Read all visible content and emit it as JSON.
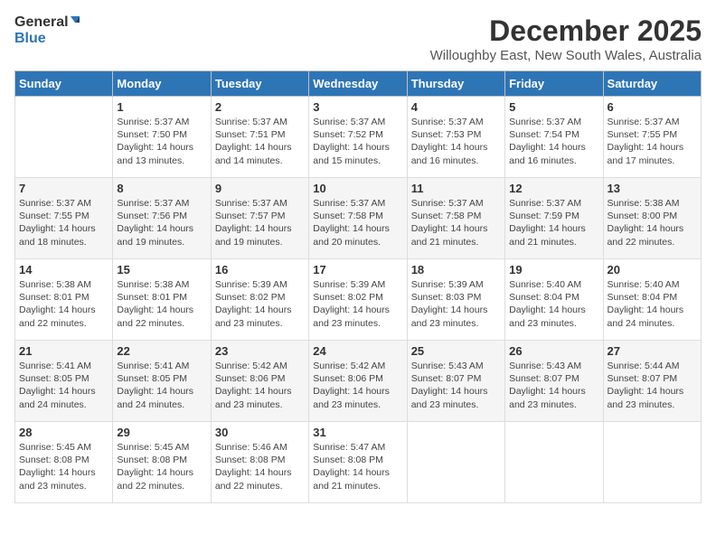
{
  "logo": {
    "general": "General",
    "blue": "Blue"
  },
  "title": "December 2025",
  "subtitle": "Willoughby East, New South Wales, Australia",
  "weekdays": [
    "Sunday",
    "Monday",
    "Tuesday",
    "Wednesday",
    "Thursday",
    "Friday",
    "Saturday"
  ],
  "weeks": [
    [
      {
        "day": "",
        "content": ""
      },
      {
        "day": "1",
        "content": "Sunrise: 5:37 AM\nSunset: 7:50 PM\nDaylight: 14 hours\nand 13 minutes."
      },
      {
        "day": "2",
        "content": "Sunrise: 5:37 AM\nSunset: 7:51 PM\nDaylight: 14 hours\nand 14 minutes."
      },
      {
        "day": "3",
        "content": "Sunrise: 5:37 AM\nSunset: 7:52 PM\nDaylight: 14 hours\nand 15 minutes."
      },
      {
        "day": "4",
        "content": "Sunrise: 5:37 AM\nSunset: 7:53 PM\nDaylight: 14 hours\nand 16 minutes."
      },
      {
        "day": "5",
        "content": "Sunrise: 5:37 AM\nSunset: 7:54 PM\nDaylight: 14 hours\nand 16 minutes."
      },
      {
        "day": "6",
        "content": "Sunrise: 5:37 AM\nSunset: 7:55 PM\nDaylight: 14 hours\nand 17 minutes."
      }
    ],
    [
      {
        "day": "7",
        "content": "Sunrise: 5:37 AM\nSunset: 7:55 PM\nDaylight: 14 hours\nand 18 minutes."
      },
      {
        "day": "8",
        "content": "Sunrise: 5:37 AM\nSunset: 7:56 PM\nDaylight: 14 hours\nand 19 minutes."
      },
      {
        "day": "9",
        "content": "Sunrise: 5:37 AM\nSunset: 7:57 PM\nDaylight: 14 hours\nand 19 minutes."
      },
      {
        "day": "10",
        "content": "Sunrise: 5:37 AM\nSunset: 7:58 PM\nDaylight: 14 hours\nand 20 minutes."
      },
      {
        "day": "11",
        "content": "Sunrise: 5:37 AM\nSunset: 7:58 PM\nDaylight: 14 hours\nand 21 minutes."
      },
      {
        "day": "12",
        "content": "Sunrise: 5:37 AM\nSunset: 7:59 PM\nDaylight: 14 hours\nand 21 minutes."
      },
      {
        "day": "13",
        "content": "Sunrise: 5:38 AM\nSunset: 8:00 PM\nDaylight: 14 hours\nand 22 minutes."
      }
    ],
    [
      {
        "day": "14",
        "content": "Sunrise: 5:38 AM\nSunset: 8:01 PM\nDaylight: 14 hours\nand 22 minutes."
      },
      {
        "day": "15",
        "content": "Sunrise: 5:38 AM\nSunset: 8:01 PM\nDaylight: 14 hours\nand 22 minutes."
      },
      {
        "day": "16",
        "content": "Sunrise: 5:39 AM\nSunset: 8:02 PM\nDaylight: 14 hours\nand 23 minutes."
      },
      {
        "day": "17",
        "content": "Sunrise: 5:39 AM\nSunset: 8:02 PM\nDaylight: 14 hours\nand 23 minutes."
      },
      {
        "day": "18",
        "content": "Sunrise: 5:39 AM\nSunset: 8:03 PM\nDaylight: 14 hours\nand 23 minutes."
      },
      {
        "day": "19",
        "content": "Sunrise: 5:40 AM\nSunset: 8:04 PM\nDaylight: 14 hours\nand 23 minutes."
      },
      {
        "day": "20",
        "content": "Sunrise: 5:40 AM\nSunset: 8:04 PM\nDaylight: 14 hours\nand 24 minutes."
      }
    ],
    [
      {
        "day": "21",
        "content": "Sunrise: 5:41 AM\nSunset: 8:05 PM\nDaylight: 14 hours\nand 24 minutes."
      },
      {
        "day": "22",
        "content": "Sunrise: 5:41 AM\nSunset: 8:05 PM\nDaylight: 14 hours\nand 24 minutes."
      },
      {
        "day": "23",
        "content": "Sunrise: 5:42 AM\nSunset: 8:06 PM\nDaylight: 14 hours\nand 23 minutes."
      },
      {
        "day": "24",
        "content": "Sunrise: 5:42 AM\nSunset: 8:06 PM\nDaylight: 14 hours\nand 23 minutes."
      },
      {
        "day": "25",
        "content": "Sunrise: 5:43 AM\nSunset: 8:07 PM\nDaylight: 14 hours\nand 23 minutes."
      },
      {
        "day": "26",
        "content": "Sunrise: 5:43 AM\nSunset: 8:07 PM\nDaylight: 14 hours\nand 23 minutes."
      },
      {
        "day": "27",
        "content": "Sunrise: 5:44 AM\nSunset: 8:07 PM\nDaylight: 14 hours\nand 23 minutes."
      }
    ],
    [
      {
        "day": "28",
        "content": "Sunrise: 5:45 AM\nSunset: 8:08 PM\nDaylight: 14 hours\nand 23 minutes."
      },
      {
        "day": "29",
        "content": "Sunrise: 5:45 AM\nSunset: 8:08 PM\nDaylight: 14 hours\nand 22 minutes."
      },
      {
        "day": "30",
        "content": "Sunrise: 5:46 AM\nSunset: 8:08 PM\nDaylight: 14 hours\nand 22 minutes."
      },
      {
        "day": "31",
        "content": "Sunrise: 5:47 AM\nSunset: 8:08 PM\nDaylight: 14 hours\nand 21 minutes."
      },
      {
        "day": "",
        "content": ""
      },
      {
        "day": "",
        "content": ""
      },
      {
        "day": "",
        "content": ""
      }
    ]
  ]
}
